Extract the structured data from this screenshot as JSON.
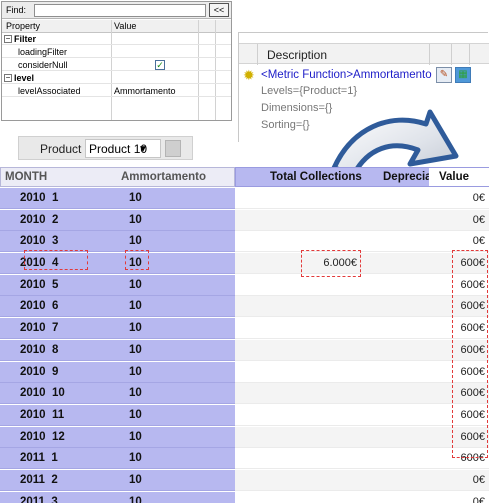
{
  "find_panel": {
    "find_label": "Find:",
    "find_value": "",
    "collapse_button": "<<",
    "col_property": "Property",
    "col_value": "Value",
    "rows": [
      {
        "key": "Filter",
        "value": "",
        "group": true,
        "toggle": "−"
      },
      {
        "key": "loadingFilter",
        "value": ""
      },
      {
        "key": "considerNull",
        "value": "",
        "checked": true
      },
      {
        "key": "level",
        "value": "",
        "group": true,
        "toggle": "−"
      },
      {
        "key": "levelAssociated",
        "value": "Ammortamento"
      }
    ]
  },
  "description_panel": {
    "header": "Description",
    "metric": "<Metric Function>Ammortamento",
    "levels": "Levels={Product=1}",
    "dimensions": "Dimensions={}",
    "sorting": "Sorting={}",
    "icons": [
      "gear-icon",
      "edit-icon",
      "table-icon"
    ]
  },
  "product_selector": {
    "label": "Product",
    "selected": "Product 10"
  },
  "grid": {
    "headers": {
      "month": "MONTH",
      "ammortamento": "Ammortamento",
      "total_collections": "Total Collections",
      "depreciation": "Deprecia",
      "value": "Value"
    },
    "rows": [
      {
        "month": "2010  1",
        "amm": "10",
        "tc": "",
        "value": "0€"
      },
      {
        "month": "2010  2",
        "amm": "10",
        "tc": "",
        "value": "0€"
      },
      {
        "month": "2010  3",
        "amm": "10",
        "tc": "",
        "value": "0€"
      },
      {
        "month": "2010  4",
        "amm": "10",
        "tc": "6.000€",
        "value": "600€"
      },
      {
        "month": "2010  5",
        "amm": "10",
        "tc": "",
        "value": "600€"
      },
      {
        "month": "2010  6",
        "amm": "10",
        "tc": "",
        "value": "600€"
      },
      {
        "month": "2010  7",
        "amm": "10",
        "tc": "",
        "value": "600€"
      },
      {
        "month": "2010  8",
        "amm": "10",
        "tc": "",
        "value": "600€"
      },
      {
        "month": "2010  9",
        "amm": "10",
        "tc": "",
        "value": "600€"
      },
      {
        "month": "2010  10",
        "amm": "10",
        "tc": "",
        "value": "600€"
      },
      {
        "month": "2010  11",
        "amm": "10",
        "tc": "",
        "value": "600€"
      },
      {
        "month": "2010  12",
        "amm": "10",
        "tc": "",
        "value": "600€"
      },
      {
        "month": "2011  1",
        "amm": "10",
        "tc": "",
        "value": "600€"
      },
      {
        "month": "2011  2",
        "amm": "10",
        "tc": "",
        "value": "0€"
      },
      {
        "month": "2011  3",
        "amm": "10",
        "tc": "",
        "value": "0€"
      }
    ]
  },
  "colors": {
    "grid_blue": "#b7b8f0",
    "highlight_red": "#e23a3a",
    "arrow_blue": "#2f5b9a"
  }
}
